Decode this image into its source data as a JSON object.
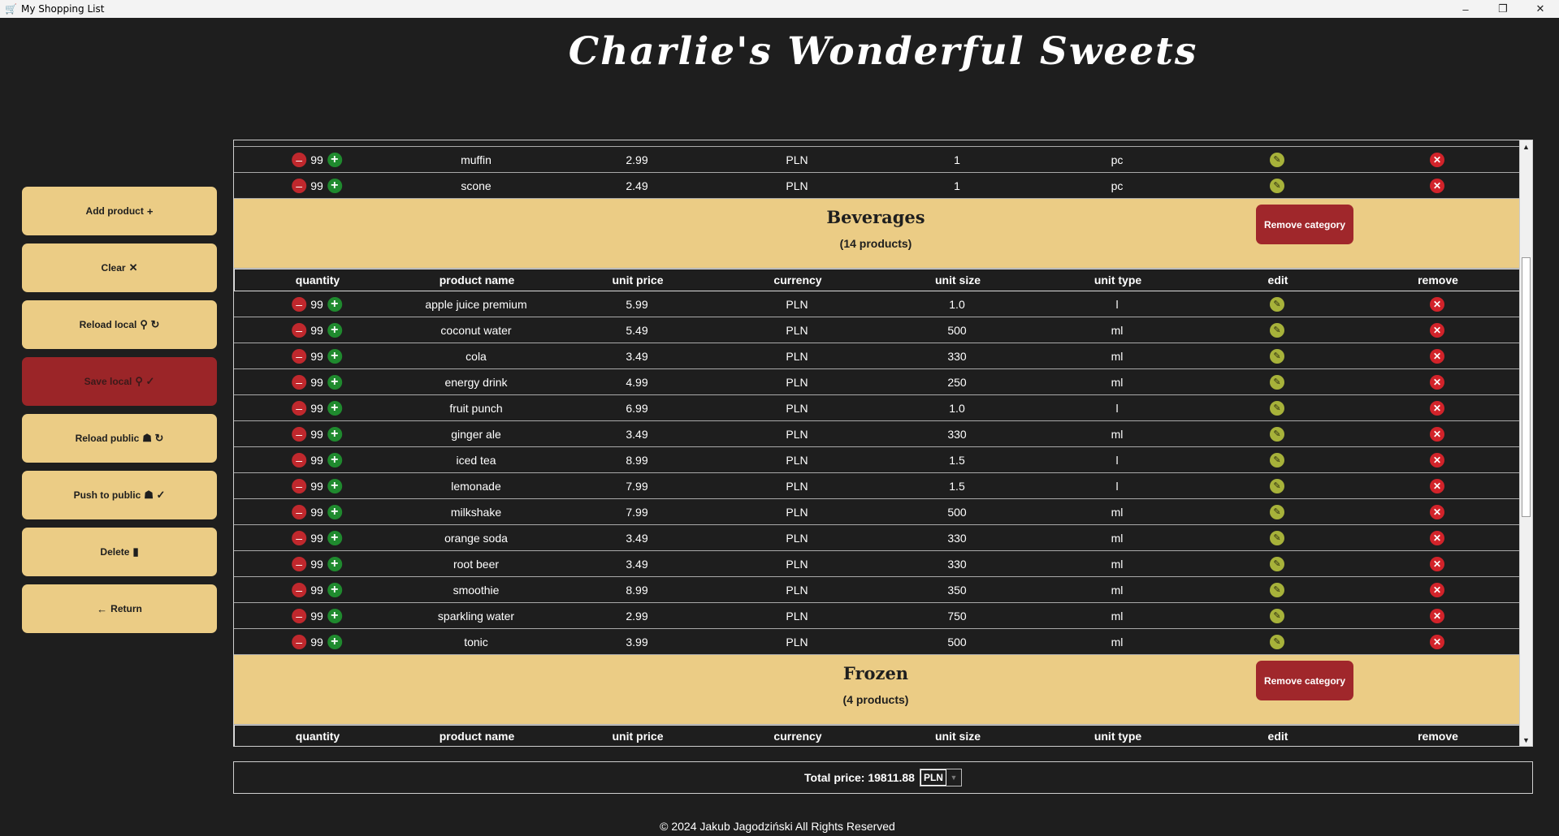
{
  "window": {
    "title": "My Shopping List",
    "icon": "cart-icon",
    "controls": [
      "–",
      "❐",
      "✕"
    ]
  },
  "heading": "Charlie's Wonderful Sweets",
  "sidebar": {
    "buttons": [
      {
        "label": "Add product",
        "icon": "+"
      },
      {
        "label": "Clear",
        "icon": "✕"
      },
      {
        "label": "Reload local",
        "icon": "⚲ ↻"
      },
      {
        "label": "Save local",
        "icon": "⚲ ✓",
        "active": true
      },
      {
        "label": "Reload public",
        "icon": "☗ ↻"
      },
      {
        "label": "Push to public",
        "icon": "☗ ✓"
      },
      {
        "label": "Delete",
        "icon": "▮"
      },
      {
        "label": "Return",
        "icon": "←"
      }
    ]
  },
  "table": {
    "columns": [
      "quantity",
      "product name",
      "unit price",
      "currency",
      "unit size",
      "unit type",
      "edit",
      "remove"
    ],
    "top_rows": [
      {
        "qty": "99",
        "name": "muffin",
        "price": "2.99",
        "currency": "PLN",
        "size": "1",
        "type": "pc"
      },
      {
        "qty": "99",
        "name": "scone",
        "price": "2.49",
        "currency": "PLN",
        "size": "1",
        "type": "pc"
      }
    ],
    "categories": [
      {
        "name": "Beverages",
        "count": "(14 products)",
        "remove_label": "Remove category",
        "rows": [
          {
            "qty": "99",
            "name": "apple juice premium",
            "price": "5.99",
            "currency": "PLN",
            "size": "1.0",
            "type": "l"
          },
          {
            "qty": "99",
            "name": "coconut water",
            "price": "5.49",
            "currency": "PLN",
            "size": "500",
            "type": "ml"
          },
          {
            "qty": "99",
            "name": "cola",
            "price": "3.49",
            "currency": "PLN",
            "size": "330",
            "type": "ml"
          },
          {
            "qty": "99",
            "name": "energy drink",
            "price": "4.99",
            "currency": "PLN",
            "size": "250",
            "type": "ml"
          },
          {
            "qty": "99",
            "name": "fruit punch",
            "price": "6.99",
            "currency": "PLN",
            "size": "1.0",
            "type": "l"
          },
          {
            "qty": "99",
            "name": "ginger ale",
            "price": "3.49",
            "currency": "PLN",
            "size": "330",
            "type": "ml"
          },
          {
            "qty": "99",
            "name": "iced tea",
            "price": "8.99",
            "currency": "PLN",
            "size": "1.5",
            "type": "l"
          },
          {
            "qty": "99",
            "name": "lemonade",
            "price": "7.99",
            "currency": "PLN",
            "size": "1.5",
            "type": "l"
          },
          {
            "qty": "99",
            "name": "milkshake",
            "price": "7.99",
            "currency": "PLN",
            "size": "500",
            "type": "ml"
          },
          {
            "qty": "99",
            "name": "orange soda",
            "price": "3.49",
            "currency": "PLN",
            "size": "330",
            "type": "ml"
          },
          {
            "qty": "99",
            "name": "root beer",
            "price": "3.49",
            "currency": "PLN",
            "size": "330",
            "type": "ml"
          },
          {
            "qty": "99",
            "name": "smoothie",
            "price": "8.99",
            "currency": "PLN",
            "size": "350",
            "type": "ml"
          },
          {
            "qty": "99",
            "name": "sparkling water",
            "price": "2.99",
            "currency": "PLN",
            "size": "750",
            "type": "ml"
          },
          {
            "qty": "99",
            "name": "tonic",
            "price": "3.99",
            "currency": "PLN",
            "size": "500",
            "type": "ml"
          }
        ]
      },
      {
        "name": "Frozen",
        "count": "(4 products)",
        "remove_label": "Remove category",
        "rows": []
      }
    ]
  },
  "total": {
    "label": "Total price: 19811.88",
    "currency": "PLN"
  },
  "footer": "© 2024 Jakub Jagodziński All Rights Reserved",
  "colors": {
    "background": "#1e1e1e",
    "button": "#ebcc85",
    "active_button": "#9b2528",
    "category_band": "#ebcc85",
    "remove_category": "#a0272b"
  }
}
